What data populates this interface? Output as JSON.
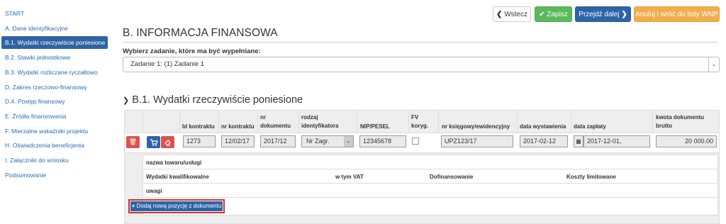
{
  "sidebar": {
    "items": [
      {
        "label": "START",
        "active": false
      },
      {
        "label": "A. Dane identyfikacyjne",
        "active": false
      },
      {
        "label": "B.1. Wydatki rzeczywiście poniesione",
        "active": true
      },
      {
        "label": "B.2. Stawki jednostkowe",
        "active": false
      },
      {
        "label": "B.3. Wydatki rozliczane ryczałtowo",
        "active": false
      },
      {
        "label": "D. Zakres rzeczowo-finansowy",
        "active": false
      },
      {
        "label": "D.4. Postęp finansowy",
        "active": false
      },
      {
        "label": "E. Źródła finansowania",
        "active": false
      },
      {
        "label": "F. Mierzalne wskaźniki projektu",
        "active": false
      },
      {
        "label": "H. Oświadczenia beneficjenta",
        "active": false
      },
      {
        "label": "I. Załączniki do wniosku",
        "active": false
      },
      {
        "label": "Podsumowanie",
        "active": false
      }
    ]
  },
  "toolbar": {
    "back_label": "Wstecz",
    "save_label": "Zapisz",
    "next_label": "Przejdź dalej",
    "cancel_label": "Anuluj i wróć do listy WNP"
  },
  "main": {
    "section_title": "B. INFORMACJA FINANSOWA",
    "choose_label": "Wybierz zadanie, które ma być wypełniane:",
    "task_selected": "Zadanie 1: (1) Zadanie 1",
    "subsection_title": "B.1. Wydatki rzeczywiście poniesione"
  },
  "table": {
    "headers": {
      "id_kontraktu": "Id kontraktu",
      "nr_kontraktu": "nr kontraktu",
      "nr_dokumentu": "nr\ndokumentu",
      "rodzaj": "rodzaj\nidentyfikatora",
      "nip": "NIP/PESEL",
      "fv": "FV\nkoryg.",
      "nr_ksieg": "nr księgowy/ewidencyjny",
      "data_wyst": "data wystawienia",
      "data_zap": "data zapłaty",
      "kwota": "kwota dokumentu\nbrutto"
    },
    "row": {
      "id_kontraktu": "1273",
      "nr_kontraktu": "12/02/17",
      "nr_dokumentu": "2017/12",
      "rodzaj": "Nr Zagr.",
      "nip": "12345678",
      "fv_checked": false,
      "nr_ksieg": "UPZ123/17",
      "data_wyst": "2017-02-12",
      "data_zap": "2017-12-01,",
      "kwota": "20 000.00"
    },
    "detail": {
      "nazwa": "nazwa towaru/usługi",
      "wydatki": "Wydatki kwalifikowalne",
      "vat": "w tym VAT",
      "dofin": "Dofinansowanie",
      "koszty": "Koszty limitowane",
      "uwagi": "uwagi"
    },
    "add_button": "Dodaj nową pozycję z dokumentu"
  },
  "colors": {
    "primary": "#2e64a5",
    "success": "#5cb85c",
    "warning": "#f0ad4e",
    "danger": "#d9534f",
    "highlight": "#d32f2f"
  }
}
